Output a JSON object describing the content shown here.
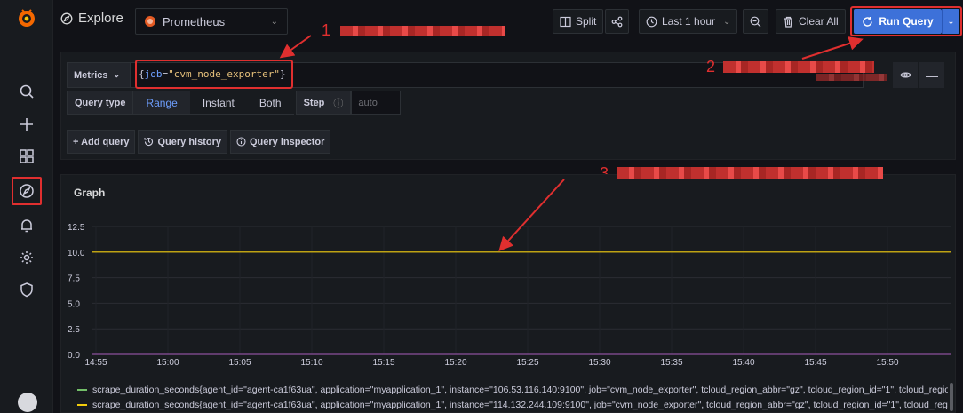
{
  "topbar": {
    "title": "Explore",
    "datasource": "Prometheus",
    "split_label": "Split",
    "time_range_label": "Last 1 hour",
    "clear_all_label": "Clear All",
    "run_query_label": "Run Query"
  },
  "query": {
    "metrics_label": "Metrics",
    "expr_key": "job",
    "expr_value": "\"cvm_node_exporter\"",
    "query_type_label": "Query type",
    "query_type_options": [
      "Range",
      "Instant",
      "Both"
    ],
    "query_type_selected": "Range",
    "step_label": "Step",
    "step_placeholder": "auto",
    "add_query_label": "+ Add query",
    "query_history_label": "Query history",
    "query_inspector_label": "Query inspector"
  },
  "annotations": [
    "1",
    "2",
    "3"
  ],
  "graph": {
    "title": "Graph"
  },
  "chart_data": {
    "type": "line",
    "title": "Graph",
    "x": [
      "14:55",
      "15:00",
      "15:05",
      "15:10",
      "15:15",
      "15:20",
      "15:25",
      "15:30",
      "15:35",
      "15:40",
      "15:45",
      "15:50"
    ],
    "y_ticks": [
      "0.0",
      "2.5",
      "5.0",
      "7.5",
      "10.0",
      "12.5"
    ],
    "ylim": [
      0,
      12.5
    ],
    "grid": true,
    "legend_placement": "bottom",
    "series": [
      {
        "name": "scrape_duration_seconds{agent_id=\"agent-ca1f63ua\", application=\"myapplication_1\", instance=\"106.53.116.140:9100\", job=\"cvm_node_exporter\", tcloud_region_abbr=\"gz\", tcloud_region_id=\"1\", tcloud_region_name",
        "color": "#73bf69",
        "values": [
          0,
          0,
          0,
          0,
          0,
          0,
          0,
          0,
          0,
          0,
          0,
          0
        ]
      },
      {
        "name": "scrape_duration_seconds{agent_id=\"agent-ca1f63ua\", application=\"myapplication_1\", instance=\"114.132.244.109:9100\", job=\"cvm_node_exporter\", tcloud_region_abbr=\"gz\", tcloud_region_id=\"1\", tcloud_region_nam",
        "color": "#f2cc0c",
        "values": [
          10,
          10,
          10,
          10,
          10,
          10,
          10,
          10,
          10,
          10,
          10,
          10
        ]
      }
    ]
  }
}
